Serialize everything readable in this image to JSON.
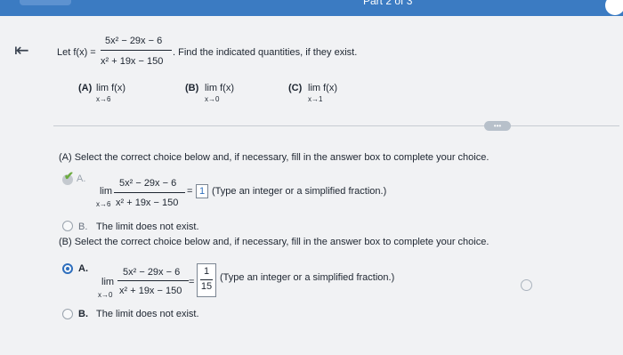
{
  "header": {
    "part": "Part 2 of 3"
  },
  "problem": {
    "let": "Let f(x) =",
    "numerator": "5x² − 29x − 6",
    "denominator": "x² + 19x − 150",
    "instruction": ". Find the indicated quantities, if they exist.",
    "items": [
      {
        "label": "(A)",
        "lim": "lim f(x)",
        "sub": "x→6"
      },
      {
        "label": "(B)",
        "lim": "lim f(x)",
        "sub": "x→0"
      },
      {
        "label": "(C)",
        "lim": "lim f(x)",
        "sub": "x→1"
      }
    ]
  },
  "more_button": "•••",
  "partA": {
    "prompt": "(A) Select the correct choice below and, if necessary, fill in the answer box to complete your choice.",
    "optA_label": "A.",
    "lim": "lim",
    "sub": "x→6",
    "numerator": "5x² − 29x − 6",
    "denominator": "x² + 19x − 150",
    "equals": "=",
    "answer": "1",
    "hint": "(Type an integer or a simplified fraction.)",
    "optB_label": "B.",
    "optB_text": "The limit does not exist."
  },
  "partB": {
    "prompt": "(B) Select the correct choice below and, if necessary, fill in the answer box to complete your choice.",
    "optA_label": "A.",
    "lim": "lim",
    "sub": "x→0",
    "numerator": "5x² − 29x − 6",
    "denominator": "x² + 19x − 150",
    "equals": "=",
    "answer_num": "1",
    "answer_den": "15",
    "hint": "(Type an integer or a simplified fraction.)",
    "optB_label": "B.",
    "optB_text": "The limit does not exist."
  },
  "colors": {
    "topbar": "#3b7bc2",
    "selected": "#2f6fbd",
    "check": "#6cab3e"
  }
}
